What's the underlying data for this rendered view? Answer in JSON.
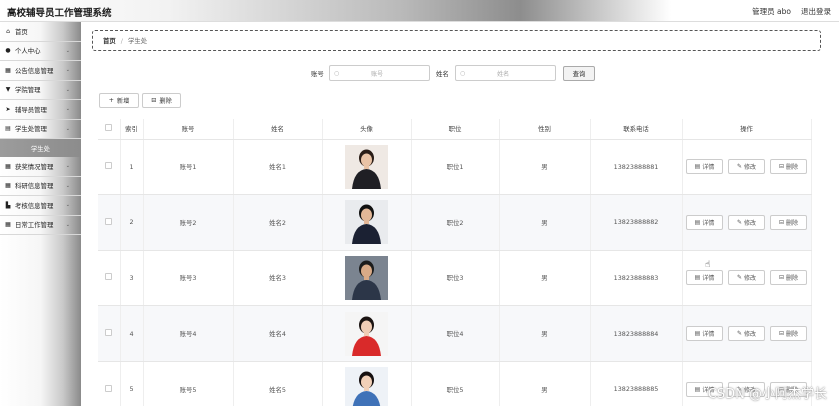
{
  "header": {
    "title": "高校辅导员工作管理系统",
    "user_label": "管理员 abo",
    "logout": "退出登录"
  },
  "sidebar": {
    "items": [
      {
        "label": "首页",
        "icon": "home-icon",
        "glyph": "⌂",
        "chevron": false
      },
      {
        "label": "个人中心",
        "icon": "user-icon",
        "glyph": "●",
        "chevron": true
      },
      {
        "label": "公告信息管理",
        "icon": "grid-icon",
        "glyph": "▦",
        "chevron": true
      },
      {
        "label": "学院管理",
        "icon": "trophy-icon",
        "glyph": "▼",
        "chevron": true
      },
      {
        "label": "辅导员管理",
        "icon": "send-icon",
        "glyph": "➤",
        "chevron": true
      },
      {
        "label": "学生处管理",
        "icon": "doc-icon",
        "glyph": "▤",
        "chevron": true
      }
    ],
    "active_sub": "学生处",
    "items_after": [
      {
        "label": "获奖情况管理",
        "icon": "grid-icon",
        "glyph": "▦",
        "chevron": true
      },
      {
        "label": "科研信息管理",
        "icon": "grid-icon",
        "glyph": "▦",
        "chevron": true
      },
      {
        "label": "考核信息管理",
        "icon": "chart-icon",
        "glyph": "▙",
        "chevron": true
      },
      {
        "label": "日常工作管理",
        "icon": "grid-icon",
        "glyph": "▦",
        "chevron": true
      }
    ]
  },
  "breadcrumb": {
    "home": "首页",
    "sep": "/",
    "current": "学生处"
  },
  "search": {
    "account_label": "账号",
    "account_placeholder": "账号",
    "name_label": "姓名",
    "name_placeholder": "姓名",
    "query_button": "查询"
  },
  "actions": {
    "add": "新增",
    "delete": "删除"
  },
  "table": {
    "headers": [
      "",
      "索引",
      "账号",
      "姓名",
      "头像",
      "职位",
      "性别",
      "联系电话",
      "操作"
    ],
    "rows": [
      {
        "index": "1",
        "account": "账号1",
        "name": "姓名1",
        "position": "职位1",
        "gender": "男",
        "phone": "13823888881"
      },
      {
        "index": "2",
        "account": "账号2",
        "name": "姓名2",
        "position": "职位2",
        "gender": "男",
        "phone": "13823888882"
      },
      {
        "index": "3",
        "account": "账号3",
        "name": "姓名3",
        "position": "职位3",
        "gender": "男",
        "phone": "13823888883"
      },
      {
        "index": "4",
        "account": "账号4",
        "name": "姓名4",
        "position": "职位4",
        "gender": "男",
        "phone": "13823888884"
      },
      {
        "index": "5",
        "account": "账号5",
        "name": "姓名5",
        "position": "职位5",
        "gender": "男",
        "phone": "13823888885"
      }
    ],
    "ops": {
      "detail": "详情",
      "edit": "修改",
      "delete": "删除"
    }
  },
  "watermark": "CSDN @小阿杰学长",
  "colors": {
    "accent_gray": "#8c8c8c",
    "active_sub_text": "#ffffff",
    "avatar_red": "#d92a2a"
  }
}
